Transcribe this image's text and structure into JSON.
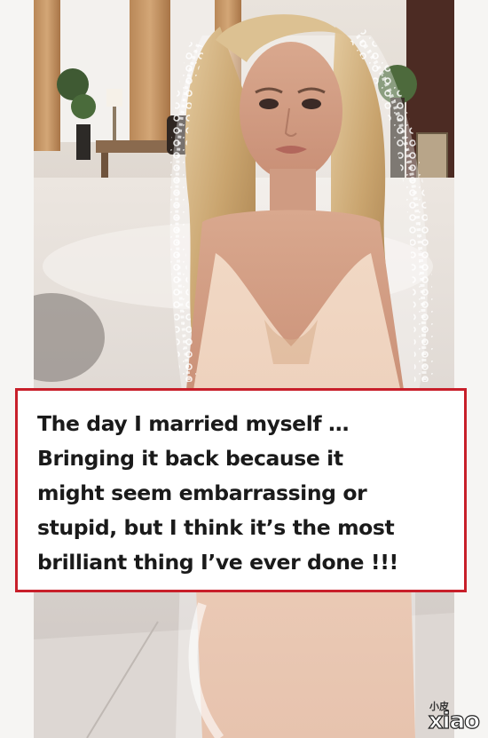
{
  "caption": {
    "lines": [
      "The day I married myself …",
      "Bringing it back because it",
      "might seem embarrassing or",
      "stupid, but I think it’s the most",
      "brilliant thing I’ve ever done !!!"
    ]
  },
  "watermark": {
    "small_text": "小皮",
    "big_text": "xiao"
  },
  "colors": {
    "caption_border": "#c81f2a",
    "caption_text": "#1a1a1a"
  },
  "icons": [
    "veil-lace",
    "hair",
    "dress"
  ]
}
